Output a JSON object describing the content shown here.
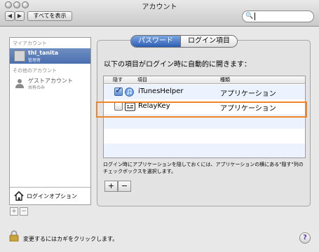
{
  "window": {
    "title": "アカウント"
  },
  "toolbar": {
    "back_glyph": "◀",
    "forward_glyph": "▶",
    "show_all": "すべてを表示",
    "search_icon_glyph": "🔍"
  },
  "sidebar": {
    "my_account_header": "マイアカウント",
    "current_user": {
      "name": "thl_tanita",
      "role": "管理者"
    },
    "other_accounts_header": "その他のアカウント",
    "guest": {
      "name": "ゲストアカウント",
      "role": "共有のみ"
    },
    "login_options": "ログインオプション",
    "add_glyph": "+",
    "remove_glyph": "−"
  },
  "tabs": [
    {
      "label": "パスワード",
      "active": true
    },
    {
      "label": "ログイン項目",
      "active": false
    }
  ],
  "login_items": {
    "lead": "以下の項目がログイン時に自動的に開きます：",
    "columns": {
      "hide": "隠す",
      "item": "項目",
      "kind": "種類"
    },
    "rows": [
      {
        "name": "iTunesHelper",
        "kind": "アプリケーション",
        "hidden": true
      },
      {
        "name": "RelayKey",
        "kind": "アプリケーション",
        "hidden": false
      }
    ],
    "note": "ログイン時にアプリケーションを隠しておくには、アプリケーションの横にある\"隠す\"列のチェックボックスを選択します。",
    "add_glyph": "+",
    "remove_glyph": "−"
  },
  "footer": {
    "lock_text": "変更するにはカギをクリックします。",
    "help_glyph": "?"
  },
  "colors": {
    "highlight": "#f08426",
    "selection": "#4a6fb0"
  }
}
